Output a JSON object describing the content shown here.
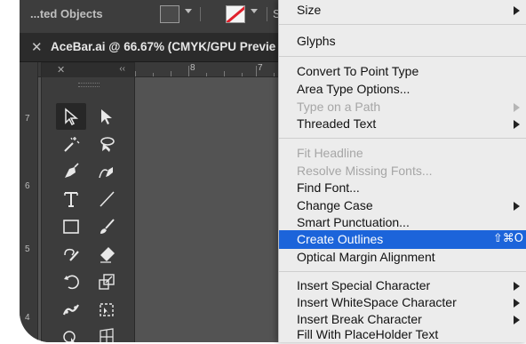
{
  "control_bar": {
    "label": "...ted Objects",
    "stroke_text": "Stro"
  },
  "document": {
    "close_symbol": "✕",
    "tab_title": "AceBar.ai @ 66.67% (CMYK/GPU Previe"
  },
  "rulers": {
    "h_labels": [
      "8",
      "7"
    ],
    "v_labels": [
      "7",
      "6",
      "5",
      "4"
    ]
  },
  "tool_panel": {
    "close_symbol": "✕",
    "collapse_symbol": "‹‹",
    "tools": [
      "selection-tool",
      "direct-selection-tool",
      "magic-wand-tool",
      "lasso-tool",
      "pen-tool",
      "curvature-tool",
      "type-tool",
      "line-segment-tool",
      "rectangle-tool",
      "paintbrush-tool",
      "shaper-tool",
      "eraser-tool",
      "rotate-tool",
      "scale-tool",
      "puppet-warp-tool",
      "free-transform-tool",
      "shape-builder-tool",
      "perspective-grid-tool"
    ]
  },
  "menu": {
    "items": [
      {
        "label": "Size",
        "submenu": true,
        "disabled": false
      },
      {
        "label": "Glyphs",
        "submenu": false,
        "disabled": false
      },
      {
        "label": "Convert To Point Type",
        "submenu": false,
        "disabled": false
      },
      {
        "label": "Area Type Options...",
        "submenu": false,
        "disabled": false
      },
      {
        "label": "Type on a Path",
        "submenu": true,
        "disabled": true
      },
      {
        "label": "Threaded Text",
        "submenu": true,
        "disabled": false
      },
      {
        "label": "Fit Headline",
        "submenu": false,
        "disabled": true
      },
      {
        "label": "Resolve Missing Fonts...",
        "submenu": false,
        "disabled": true
      },
      {
        "label": "Find Font...",
        "submenu": false,
        "disabled": false
      },
      {
        "label": "Change Case",
        "submenu": true,
        "disabled": false
      },
      {
        "label": "Smart Punctuation...",
        "submenu": false,
        "disabled": false
      },
      {
        "label": "Create Outlines",
        "submenu": false,
        "disabled": false,
        "highlighted": true,
        "shortcut": "⇧⌘O"
      },
      {
        "label": "Optical Margin Alignment",
        "submenu": false,
        "disabled": false
      },
      {
        "label": "Insert Special Character",
        "submenu": true,
        "disabled": false
      },
      {
        "label": "Insert WhiteSpace Character",
        "submenu": true,
        "disabled": false
      },
      {
        "label": "Insert Break Character",
        "submenu": true,
        "disabled": false
      },
      {
        "label": "Fill With PlaceHolder Text",
        "submenu": false,
        "disabled": false
      }
    ]
  },
  "colors": {
    "highlight": "#1c64da",
    "app_bg": "#535353",
    "menu_bg": "#ececec"
  }
}
